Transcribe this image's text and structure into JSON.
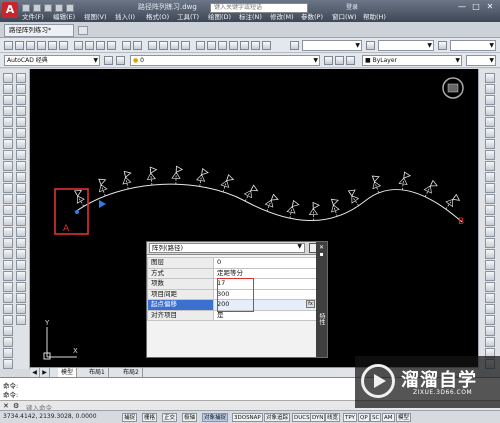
{
  "app": {
    "logo": "A",
    "doc_title": "路径阵列练习.dwg",
    "search_placeholder": "键入关键字或短语",
    "login": "登录",
    "window_controls": [
      "—",
      "□",
      "✕"
    ]
  },
  "menu": [
    "文件(F)",
    "编辑(E)",
    "视图(V)",
    "插入(I)",
    "格式(O)",
    "工具(T)",
    "绘图(D)",
    "标注(N)",
    "修改(M)",
    "参数(P)",
    "窗口(W)",
    "帮助(H)"
  ],
  "doc_tab": "路径阵列练习*",
  "toolbar": {
    "workspace": "AutoCAD 经典",
    "layer_value": "0",
    "color_value": "ByLayer"
  },
  "drawing": {
    "label_a": "A",
    "label_b": "B",
    "ucs_y": "Y",
    "ucs_x": "X",
    "colors": {
      "path": "#e6e6e6",
      "highlight": "#e0312f",
      "marker": "#2f7ee8"
    }
  },
  "properties": {
    "type_select": "阵列(路径)",
    "side_label": "特性",
    "rows": [
      {
        "key": "图层",
        "value": "0"
      },
      {
        "key": "方式",
        "value": "定距等分"
      },
      {
        "key": "项数",
        "value": "17"
      },
      {
        "key": "项目间距",
        "value": "300"
      },
      {
        "key": "起点偏移",
        "value": "200",
        "selected": true
      },
      {
        "key": "对齐项目",
        "value": "是"
      }
    ]
  },
  "layout_tabs": [
    "模型",
    "布局1",
    "布局2"
  ],
  "command": {
    "history": [
      "命令:",
      "命令:"
    ],
    "prompt": "键入命令"
  },
  "status": {
    "coords": "3734.4142, 2139.3028, 0.0000",
    "buttons": [
      "捕捉",
      "栅格",
      "正交",
      "极轴",
      "对象捕捉",
      "3DOSNAP",
      "对象追踪",
      "DUCS",
      "DYN",
      "线宽",
      "TPY",
      "QP",
      "SC",
      "AM",
      "模型"
    ]
  },
  "watermark": {
    "brand": "溜溜自学",
    "url": "ZIXUE.3D66.COM"
  }
}
